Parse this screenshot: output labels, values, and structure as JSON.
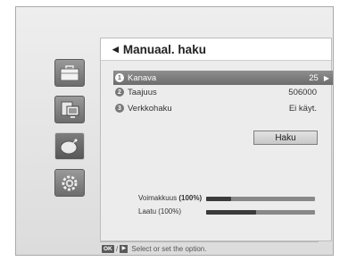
{
  "side_menu": [
    {
      "icon": "briefcase-icon"
    },
    {
      "icon": "monitor-icon"
    },
    {
      "icon": "satellite-dish-icon",
      "active": true
    },
    {
      "icon": "gear-icon"
    }
  ],
  "panel": {
    "title": "Manuaal. haku",
    "rows": [
      {
        "num": "1",
        "label": "Kanava",
        "value": "25",
        "selected": true
      },
      {
        "num": "2",
        "label": "Taajuus",
        "value": "506000"
      },
      {
        "num": "3",
        "label": "Verkkohaku",
        "value": "Ei käyt."
      }
    ],
    "search_button": "Haku"
  },
  "signal": {
    "strength_prefix": "Voimakkuus ",
    "strength_value": "(100%)",
    "strength_fraction": 0.23,
    "quality_label": "Laatu (100%)",
    "quality_fraction": 0.46
  },
  "hint": {
    "ok_key": "OK",
    "separator": " / ",
    "text": "Select or set the option."
  }
}
